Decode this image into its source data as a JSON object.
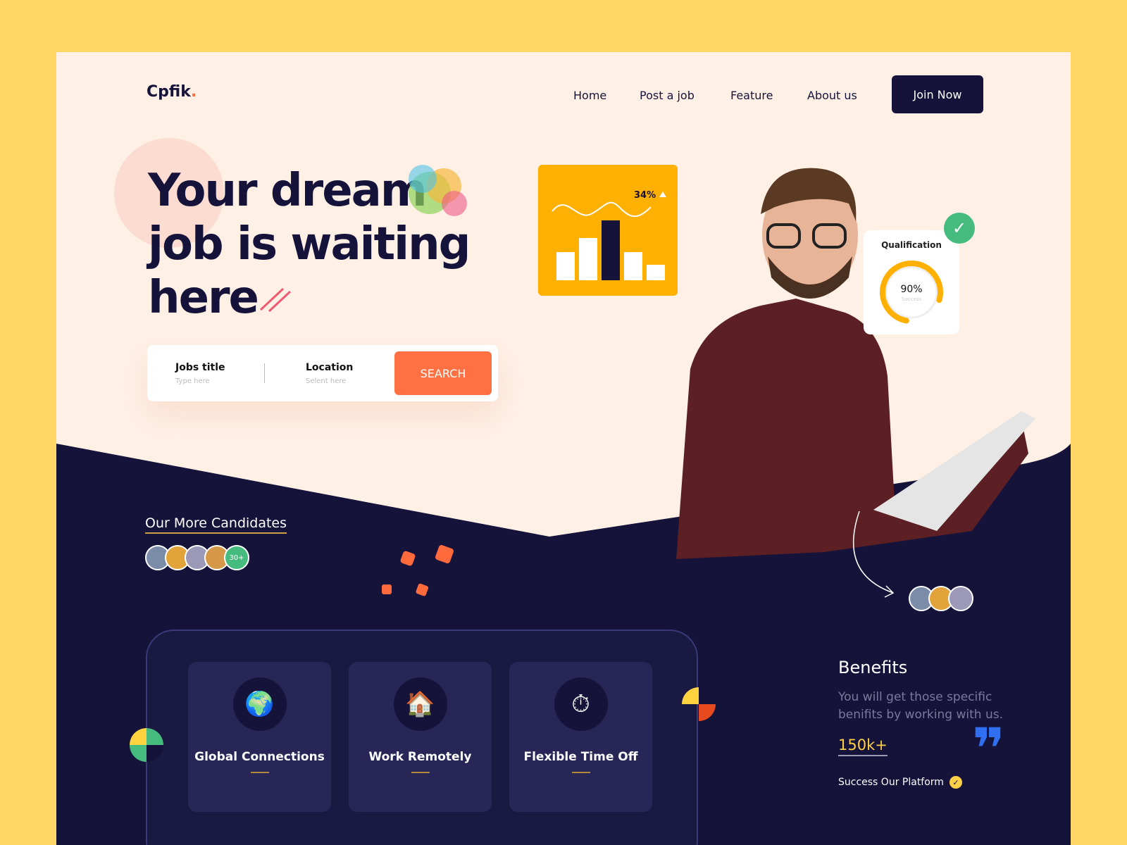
{
  "brand": {
    "name": "Cpfik",
    "dot": "."
  },
  "nav": {
    "items": [
      "Home",
      "Post a job",
      "Feature",
      "About us"
    ],
    "cta": "Join Now"
  },
  "hero": {
    "lines": [
      "Your dream",
      "job is waiting",
      "here"
    ]
  },
  "search": {
    "job_label": "Jobs title",
    "job_placeholder": "Type here",
    "location_label": "Location",
    "location_placeholder": "Selent here",
    "button": "SEARCH"
  },
  "chart_card": {
    "percent": "34%",
    "bars": [
      40,
      60,
      85,
      40,
      22
    ]
  },
  "qualification": {
    "title": "Qualification",
    "value": "90%",
    "sub": "Success",
    "progress": 0.9
  },
  "candidates": {
    "title": "Our More Candidates",
    "count": "30+"
  },
  "features": [
    {
      "icon": "globe-icon",
      "label": "Global Connections"
    },
    {
      "icon": "house-icon",
      "label": "Work Remotely"
    },
    {
      "icon": "clock-badge-icon",
      "label": "Flexible Time Off"
    }
  ],
  "benefits": {
    "title": "Benefits",
    "text": "You will get those specific benifits by working with us.",
    "stat": "150k+",
    "caption": "Success Our Platform"
  },
  "colors": {
    "navy": "#15133a",
    "orange": "#ff7043",
    "yellow": "#ffb000",
    "cream": "#fff0e6",
    "green": "#46bb7e"
  }
}
